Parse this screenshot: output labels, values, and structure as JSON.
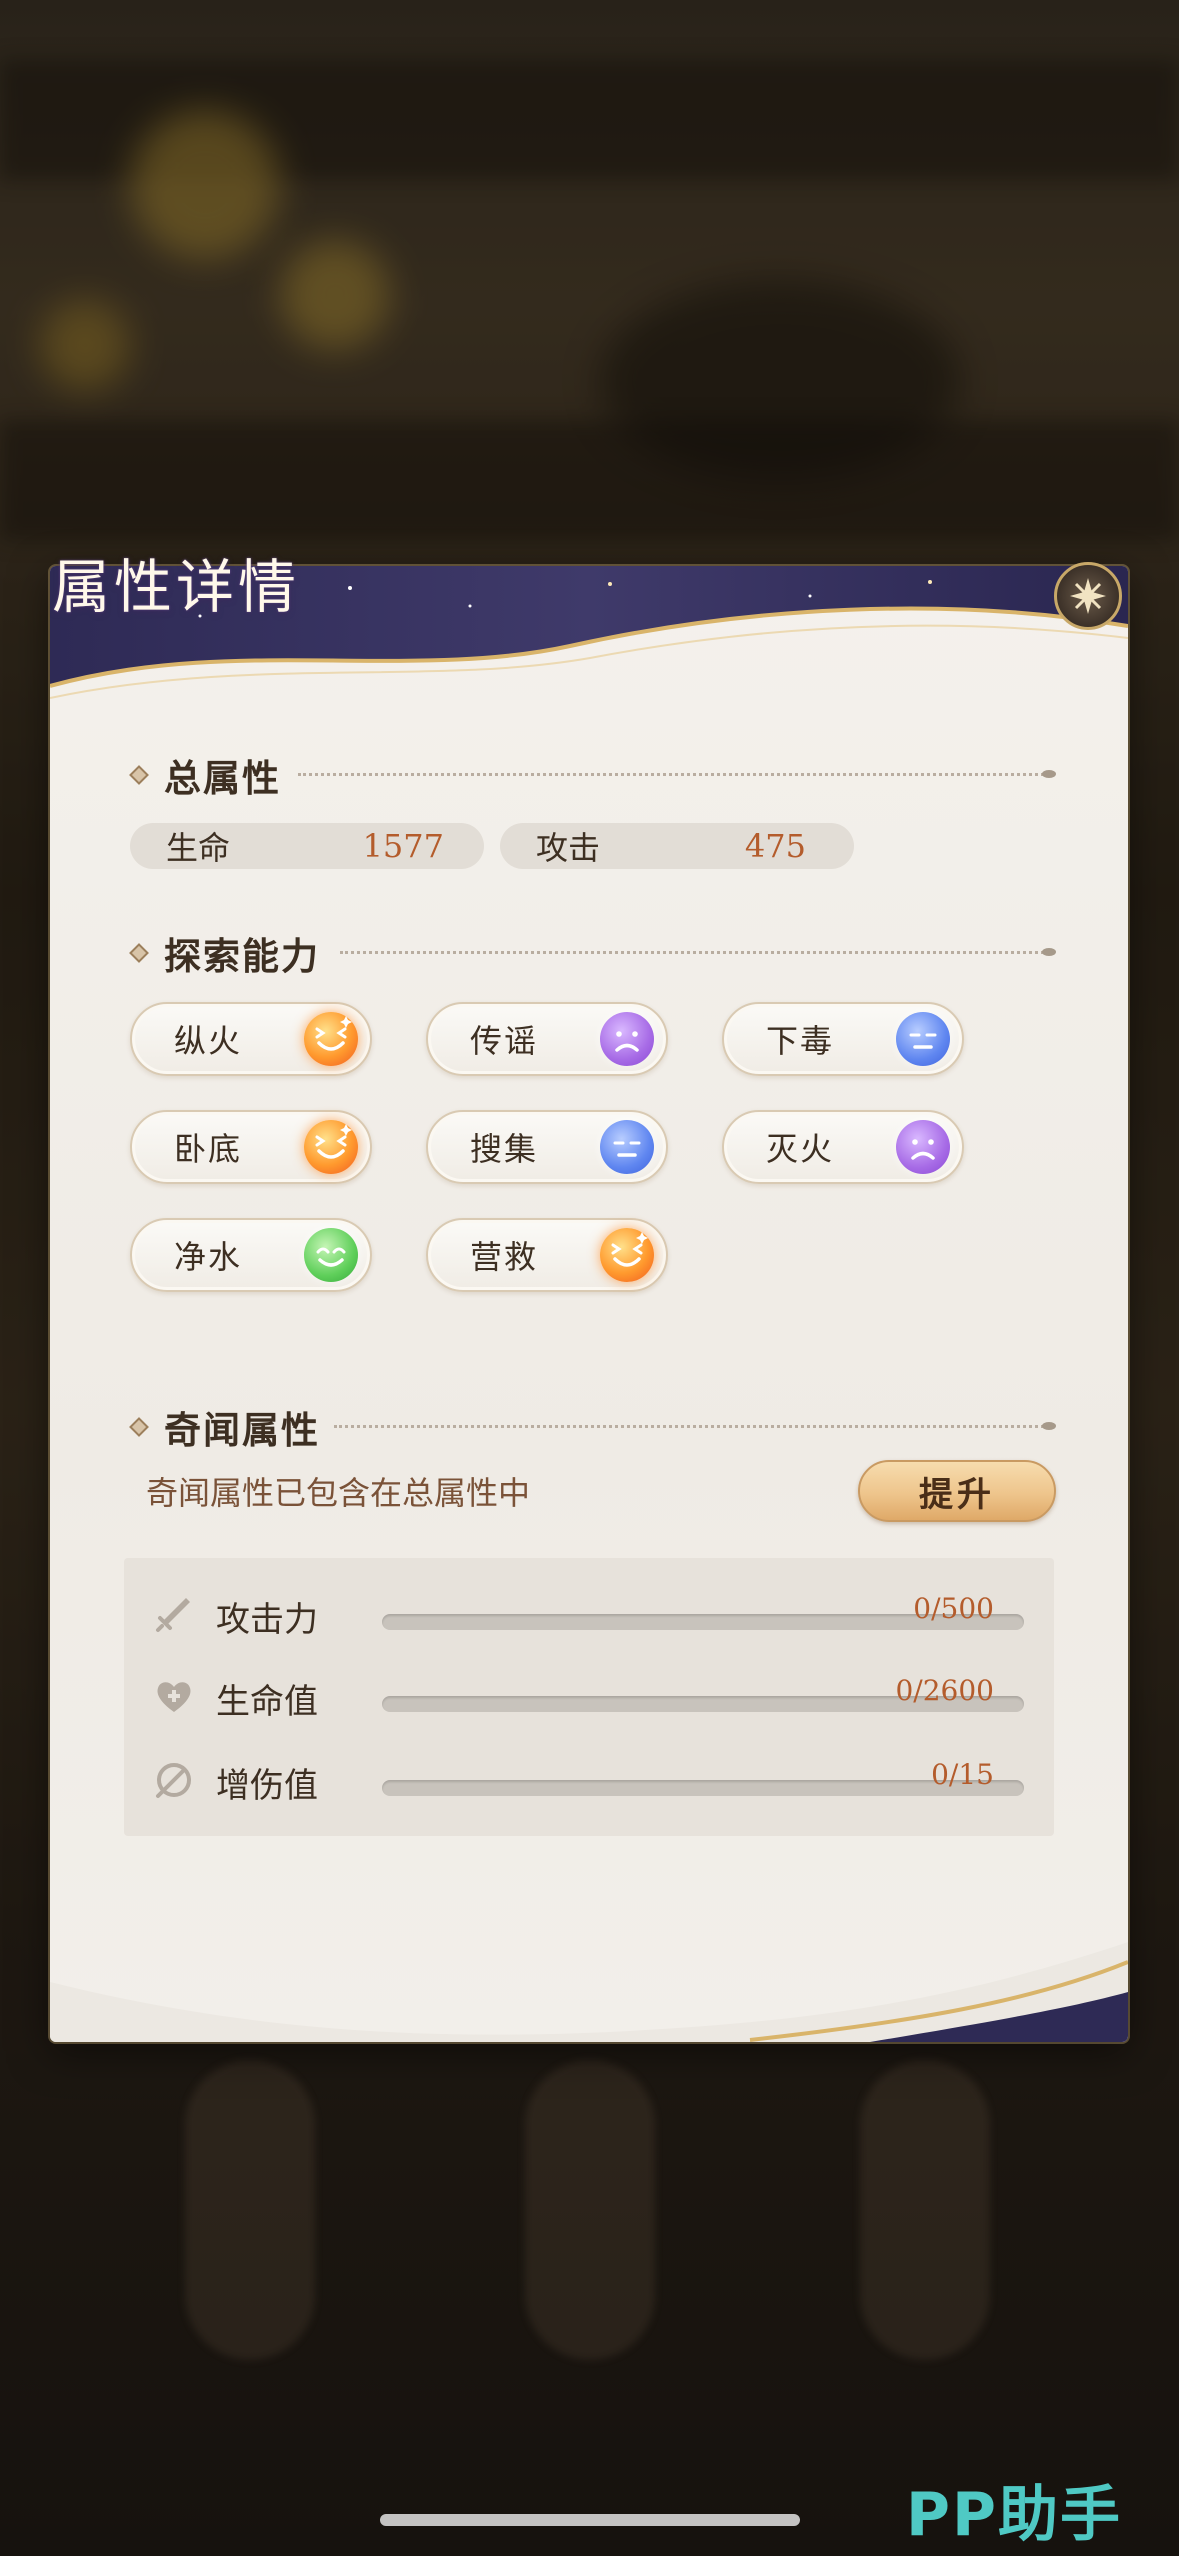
{
  "title": "属性详情",
  "total": {
    "heading": "总属性",
    "stats": [
      {
        "label": "生命",
        "value": "1577"
      },
      {
        "label": "攻击",
        "value": "475"
      }
    ]
  },
  "explore": {
    "heading": "探索能力",
    "abilities": [
      {
        "name": "纵火",
        "mood": "excited",
        "color": "orange"
      },
      {
        "name": "传谣",
        "mood": "sad",
        "color": "purple"
      },
      {
        "name": "下毒",
        "mood": "neutral",
        "color": "blue"
      },
      {
        "name": "卧底",
        "mood": "excited",
        "color": "orange"
      },
      {
        "name": "搜集",
        "mood": "neutral",
        "color": "blue"
      },
      {
        "name": "灭火",
        "mood": "sad",
        "color": "purple"
      },
      {
        "name": "净水",
        "mood": "happy",
        "color": "green"
      },
      {
        "name": "营救",
        "mood": "excited",
        "color": "orange"
      }
    ]
  },
  "qiwen": {
    "heading": "奇闻属性",
    "description": "奇闻属性已包含在总属性中",
    "upgrade_label": "提升",
    "bonuses": [
      {
        "label": "攻击力",
        "value": "0/500",
        "progress": 0,
        "icon": "sword-icon"
      },
      {
        "label": "生命值",
        "value": "0/2600",
        "progress": 0,
        "icon": "heart-plus-icon"
      },
      {
        "label": "增伤值",
        "value": "0/15",
        "progress": 0,
        "icon": "damage-boost-icon"
      }
    ]
  },
  "watermark": "PP助手"
}
